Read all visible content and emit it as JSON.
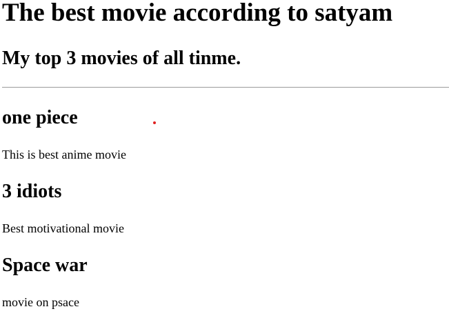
{
  "header": {
    "title": "The best movie according to satyam",
    "subtitle": "My top 3 movies of all tinme."
  },
  "movies": [
    {
      "title": "one piece",
      "description": "This is best anime movie"
    },
    {
      "title": "3 idiots",
      "description": "Best motivational movie"
    },
    {
      "title": "Space war",
      "description": "movie on psace"
    }
  ],
  "colors": {
    "text": "#000000",
    "divider": "#9a9a9a",
    "cursor_dot": "#e02020"
  }
}
